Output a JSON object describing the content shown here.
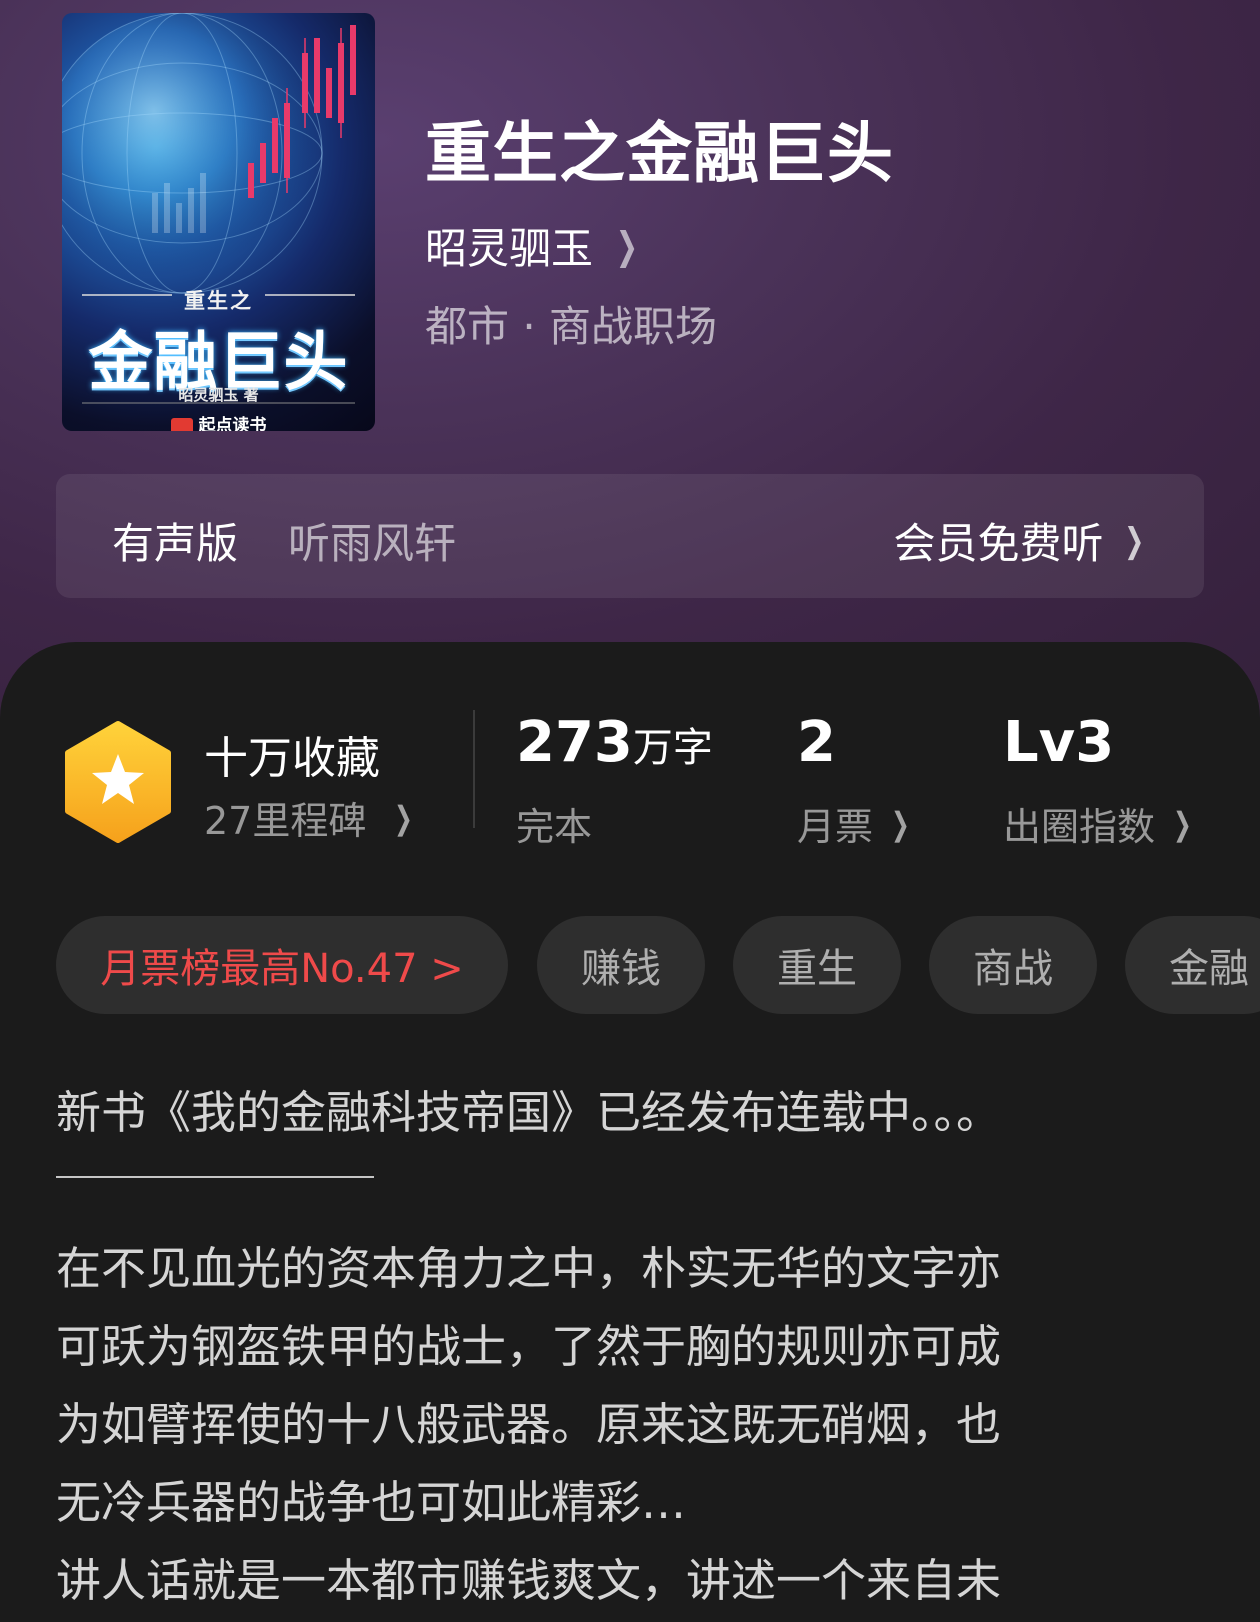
{
  "book": {
    "title": "重生之金融巨头",
    "author": "昭灵驷玉",
    "genre": "都市 · 商战职场"
  },
  "cover": {
    "subtitle_text": "重生之",
    "title_text": "金融巨头",
    "author_text": "昭灵驷玉 著",
    "publisher_text": "起点读书"
  },
  "audio": {
    "label": "有声版",
    "narrator": "听雨风轩",
    "cta": "会员免费听"
  },
  "stats": {
    "collect_title": "十万收藏",
    "collect_sub": "27里程碑",
    "words_number": "273",
    "words_unit": "万字",
    "words_sub": "完本",
    "monthly_number": "2",
    "monthly_sub": "月票",
    "index_number": "Lv3",
    "index_sub": "出圈指数"
  },
  "tags": {
    "rank": "月票榜最高No.47 >",
    "t1": "赚钱",
    "t2": "重生",
    "t3": "商战",
    "t4": "金融"
  },
  "description": {
    "line1": "新书《我的金融科技帝国》已经发布连载中。。。",
    "line2": "在不见血光的资本角力之中，朴实无华的文字亦",
    "line3": "可跃为钢盔铁甲的战士，了然于胸的规则亦可成",
    "line4": "为如臂挥使的十八般武器。原来这既无硝烟，也",
    "line5": "无冷兵器的战争也可如此精彩…",
    "line6": "讲人话就是一本都市赚钱爽文，讲述一个来自未"
  },
  "colors": {
    "hero_bg": "#3e2647",
    "panel_bg": "#1b1b1b",
    "rank_red": "#ef4a4a",
    "badge_gold": "#fbb321"
  },
  "icons": {
    "chevron": "chevron-right-icon",
    "badge": "star-hexagon-icon"
  }
}
